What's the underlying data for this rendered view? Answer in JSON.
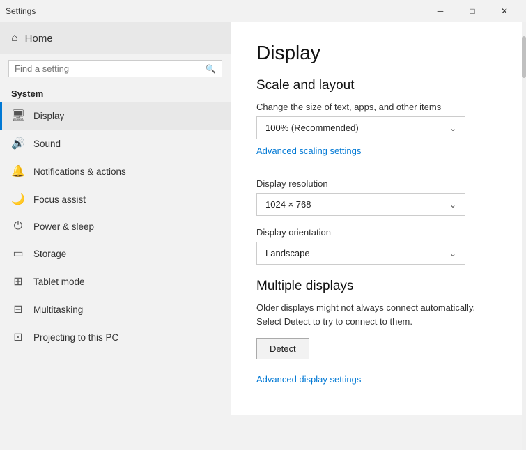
{
  "titlebar": {
    "title": "Settings",
    "minimize": "─",
    "maximize": "□",
    "close": "✕"
  },
  "sidebar": {
    "home_label": "Home",
    "search_placeholder": "Find a setting",
    "section_title": "System",
    "items": [
      {
        "id": "display",
        "label": "Display",
        "icon": "🖥",
        "active": true
      },
      {
        "id": "sound",
        "label": "Sound",
        "icon": "🔊",
        "active": false
      },
      {
        "id": "notifications",
        "label": "Notifications & actions",
        "icon": "🔔",
        "active": false
      },
      {
        "id": "focus",
        "label": "Focus assist",
        "icon": "🌙",
        "active": false
      },
      {
        "id": "power",
        "label": "Power & sleep",
        "icon": "⏻",
        "active": false
      },
      {
        "id": "storage",
        "label": "Storage",
        "icon": "▭",
        "active": false
      },
      {
        "id": "tablet",
        "label": "Tablet mode",
        "icon": "⊞",
        "active": false
      },
      {
        "id": "multitasking",
        "label": "Multitasking",
        "icon": "⊟",
        "active": false
      },
      {
        "id": "projecting",
        "label": "Projecting to this PC",
        "icon": "⊡",
        "active": false
      }
    ]
  },
  "main": {
    "page_title": "Display",
    "scale_section": {
      "title": "Scale and layout",
      "scale_label": "Change the size of text, apps, and other items",
      "scale_value": "100% (Recommended)",
      "advanced_link": "Advanced scaling settings",
      "resolution_label": "Display resolution",
      "resolution_value": "1024 × 768",
      "orientation_label": "Display orientation",
      "orientation_value": "Landscape"
    },
    "multiple_displays": {
      "title": "Multiple displays",
      "info_text_1": "Older displays might not always connect automatically.",
      "info_text_2": "Select Detect to try to connect to them.",
      "detect_btn": "Detect",
      "advanced_link": "Advanced display settings"
    }
  }
}
